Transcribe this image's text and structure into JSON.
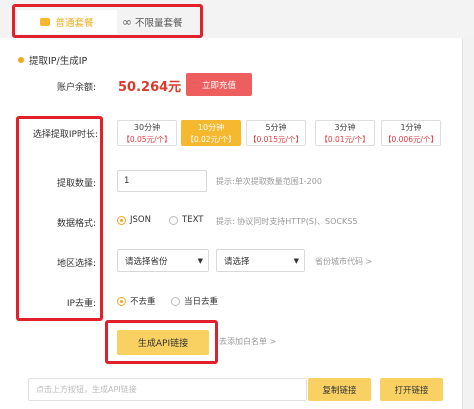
{
  "tabs": {
    "normal": {
      "label": "普通套餐",
      "icon": "box-icon"
    },
    "unlimited": {
      "label": "不限量套餐",
      "icon": "infinity-icon"
    }
  },
  "section_title": "提取IP/生成IP",
  "balance": {
    "label": "账户余额:",
    "value": "50.264元",
    "recharge_label": "立即充值"
  },
  "duration": {
    "label": "选择提取IP时长:",
    "options": [
      {
        "name": "30分钟",
        "price": "【0.05元/个】",
        "selected": false
      },
      {
        "name": "10分钟",
        "price": "【0.02元/个】",
        "selected": true
      },
      {
        "name": "5分钟",
        "price": "【0.015元/个】",
        "selected": false
      },
      {
        "name": "3分钟",
        "price": "【0.01元/个】",
        "selected": false
      },
      {
        "name": "1分钟",
        "price": "【0.006元/个】",
        "selected": false
      }
    ]
  },
  "quantity": {
    "label": "提取数量:",
    "value": "1",
    "hint": "提示:单次提取数量范围1-200"
  },
  "format": {
    "label": "数据格式:",
    "options": [
      {
        "label": "JSON",
        "checked": true
      },
      {
        "label": "TEXT",
        "checked": false
      }
    ],
    "hint": "提示: 协议同时支持HTTP(S)、SOCKS5"
  },
  "region": {
    "label": "地区选择:",
    "province_placeholder": "请选择省份",
    "city_placeholder": "请选择",
    "link": "省份城市代码 >"
  },
  "dedupe": {
    "label": "IP去重:",
    "options": [
      {
        "label": "不去重",
        "checked": true
      },
      {
        "label": "当日去重",
        "checked": false
      }
    ]
  },
  "generate": {
    "label": "生成API链接",
    "whitelist_link": "去添加白名单 >"
  },
  "api_link": {
    "placeholder": "点击上方按钮，生成API链接",
    "copy_label": "复制链接",
    "open_label": "打开链接"
  },
  "colors": {
    "accent": "#f5b82e",
    "highlight": "#e0202a",
    "price": "#e4393c"
  }
}
